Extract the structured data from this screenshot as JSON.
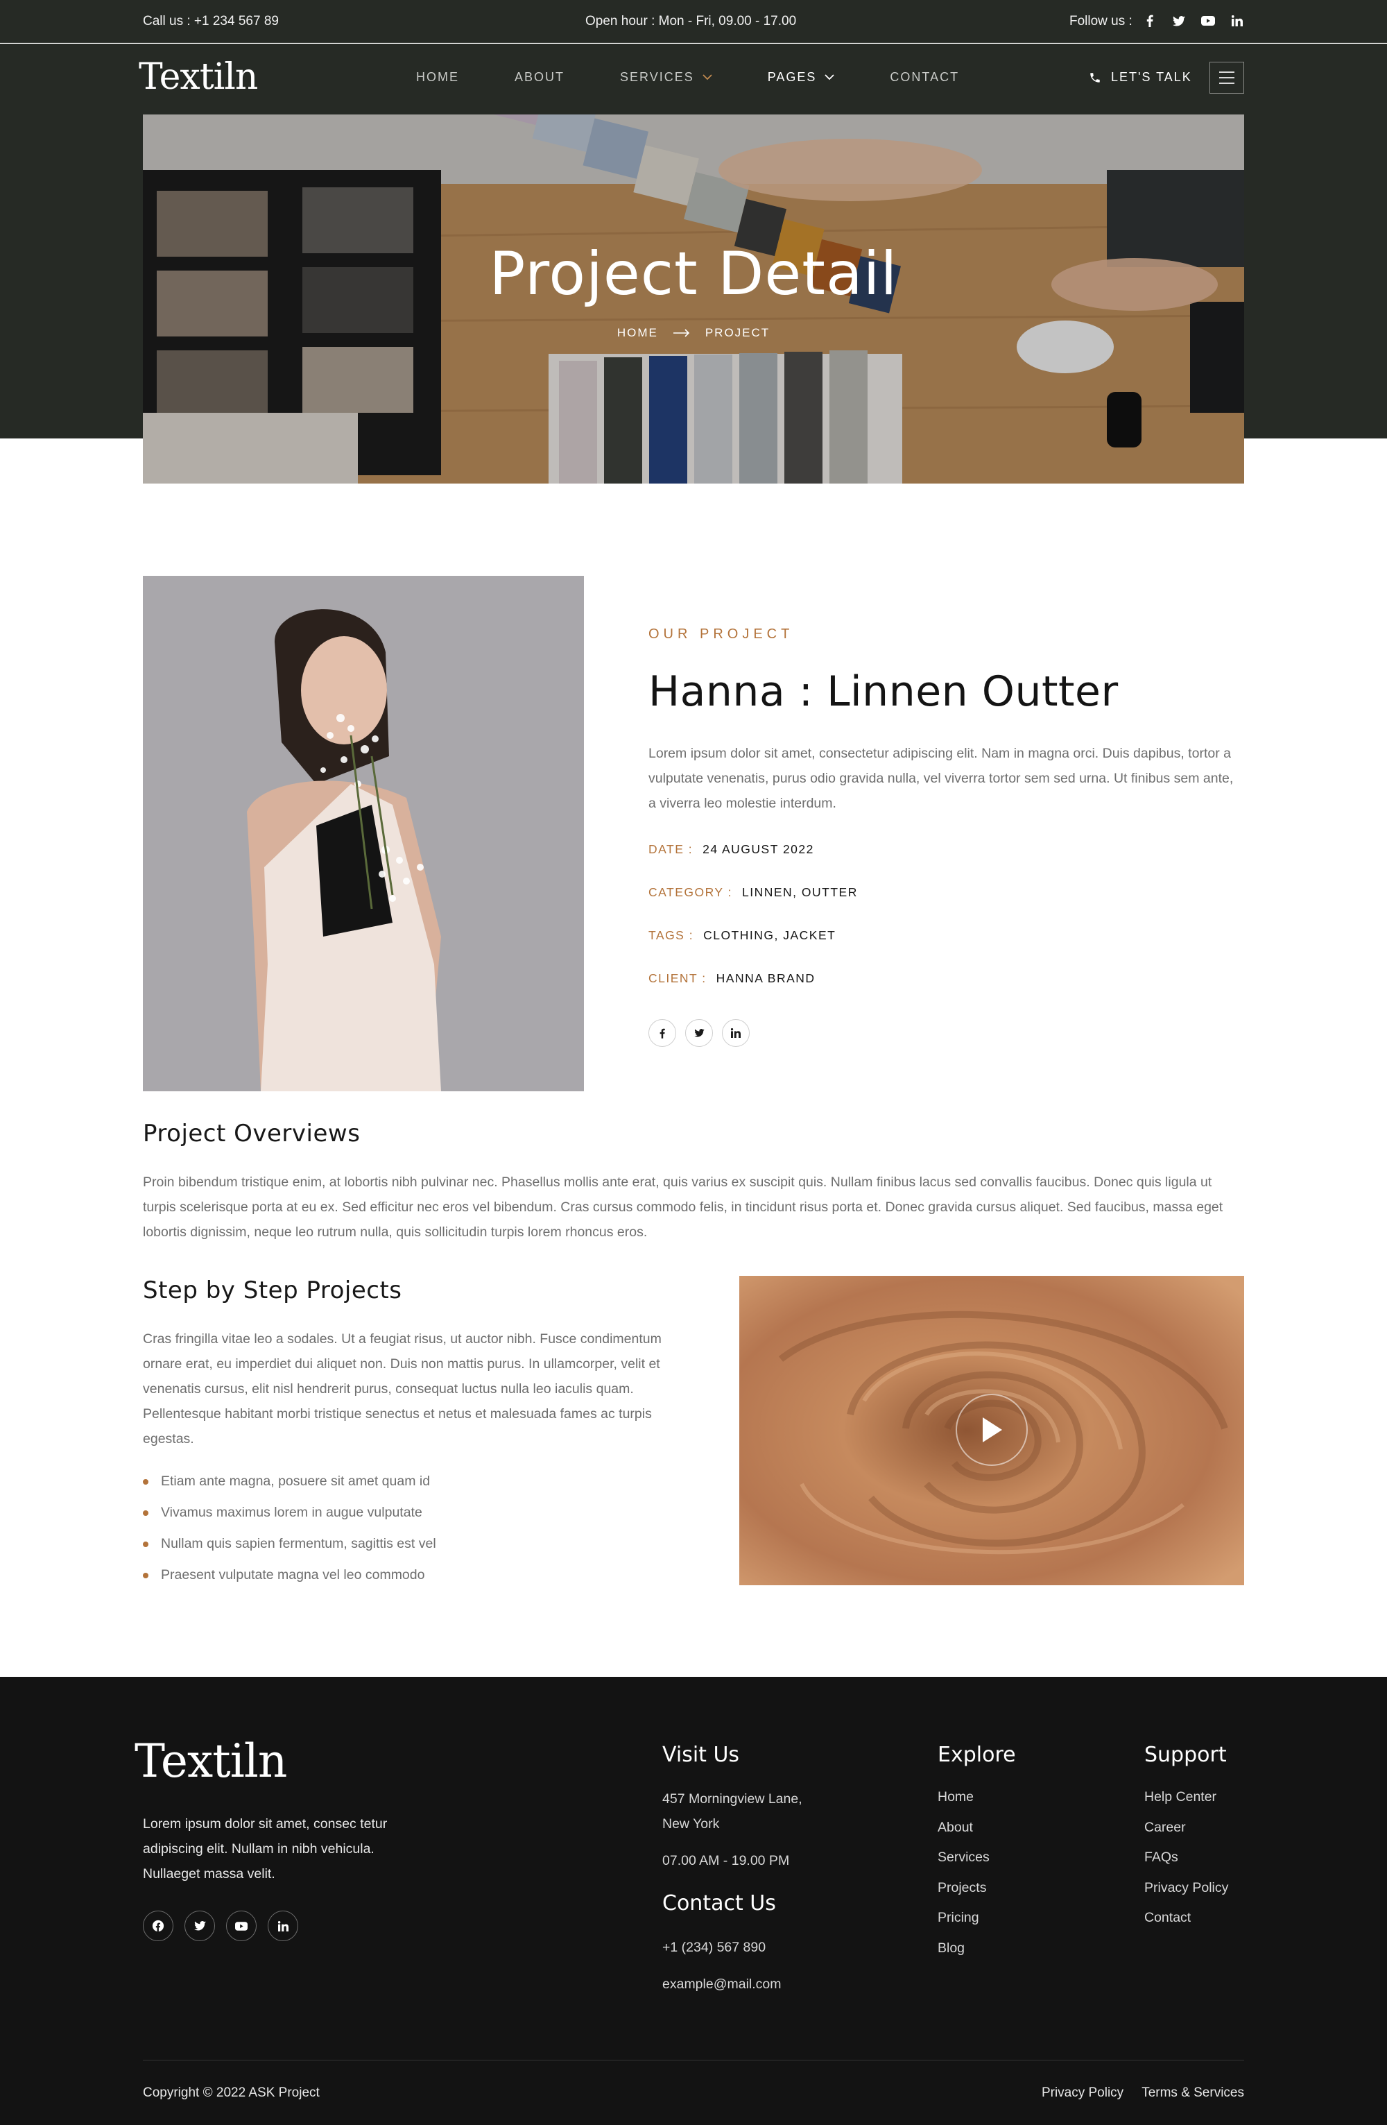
{
  "topbar": {
    "call": "Call us : +1 234 567 89",
    "hours": "Open hour : Mon - Fri, 09.00 - 17.00",
    "follow": "Follow us :"
  },
  "brand": {
    "logo": "Textiln"
  },
  "nav": {
    "items": [
      {
        "label": "HOME"
      },
      {
        "label": "ABOUT"
      },
      {
        "label": "SERVICES"
      },
      {
        "label": "PAGES"
      },
      {
        "label": "CONTACT"
      }
    ],
    "cta": "LET'S TALK"
  },
  "hero": {
    "title": "Project Detail",
    "crumb_home": "HOME",
    "crumb_current": "PROJECT"
  },
  "project": {
    "eyebrow": "OUR PROJECT",
    "title": "Hanna : Linnen Outter",
    "description": "Lorem ipsum dolor sit amet, consectetur adipiscing elit. Nam in magna orci. Duis dapibus, tortor a vulputate venenatis, purus odio gravida nulla, vel viverra tortor sem sed urna. Ut finibus sem ante, a viverra leo molestie interdum.",
    "meta": [
      {
        "key": "DATE :",
        "value": "24 AUGUST 2022"
      },
      {
        "key": "CATEGORY :",
        "value": "LINNEN, OUTTER"
      },
      {
        "key": "TAGS :",
        "value": "CLOTHING, JACKET"
      },
      {
        "key": "CLIENT :",
        "value": "HANNA BRAND"
      }
    ]
  },
  "overview": {
    "heading": "Project Overviews",
    "text": "Proin bibendum tristique enim, at lobortis nibh pulvinar nec. Phasellus mollis ante erat, quis varius ex suscipit quis. Nullam finibus lacus sed convallis faucibus. Donec quis ligula ut turpis scelerisque porta at eu ex. Sed efficitur nec eros vel bibendum. Cras cursus commodo felis, in tincidunt risus porta et. Donec gravida cursus aliquet. Sed faucibus, massa eget lobortis dignissim, neque leo rutrum nulla, quis sollicitudin turpis lorem rhoncus eros."
  },
  "steps": {
    "heading": "Step by Step Projects",
    "text": "Cras fringilla vitae leo a sodales. Ut a feugiat risus, ut auctor nibh. Fusce condimentum ornare erat, eu imperdiet dui aliquet non. Duis non mattis purus. In ullamcorper, velit et venenatis cursus, elit nisl hendrerit purus, consequat luctus nulla leo iaculis quam. Pellentesque habitant morbi tristique senectus et netus et malesuada fames ac turpis egestas.",
    "bullets": [
      "Etiam ante magna, posuere sit amet quam id",
      "Vivamus maximus lorem in augue vulputate",
      "Nullam quis sapien fermentum, sagittis est vel",
      "Praesent vulputate magna vel leo commodo"
    ]
  },
  "footer": {
    "logo": "Textiln",
    "about": "Lorem ipsum dolor sit amet, consec tetur adipiscing elit. Nullam in nibh vehicula. Nullaeget massa velit.",
    "visit_heading": "Visit Us",
    "address_line1": "457 Morningview Lane,",
    "address_line2": "New York",
    "hours": "07.00 AM - 19.00 PM",
    "contact_heading": "Contact Us",
    "phone": "+1 (234) 567 890",
    "email": "example@mail.com",
    "explore_heading": "Explore",
    "explore": [
      "Home",
      "About",
      "Services",
      "Projects",
      "Pricing",
      "Blog"
    ],
    "support_heading": "Support",
    "support": [
      "Help Center",
      "Career",
      "FAQs",
      "Privacy Policy",
      "Contact"
    ],
    "copyright": "Copyright © 2022 ASK Project",
    "privacy": "Privacy Policy",
    "terms": "Terms & Services"
  },
  "colors": {
    "dark_green": "#262a25",
    "accent": "#b3733a",
    "footer_bg": "#131313"
  },
  "icons": {
    "social": [
      "facebook-icon",
      "twitter-icon",
      "youtube-icon",
      "linkedin-icon"
    ],
    "cta": "phone-icon",
    "menu": "hamburger-icon",
    "video": "play-icon"
  }
}
